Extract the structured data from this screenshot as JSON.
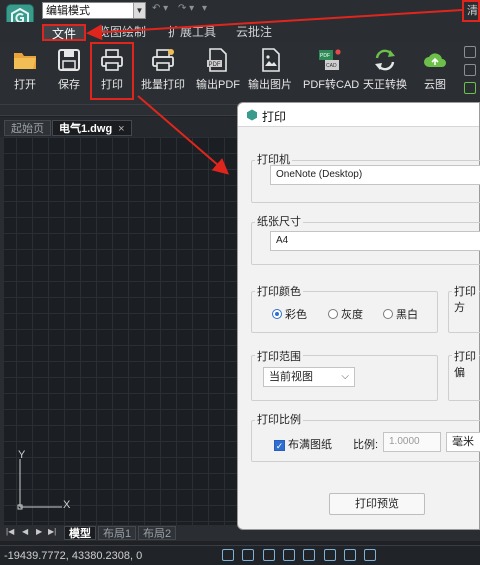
{
  "app": {
    "mode_select": "编辑模式",
    "title_right_text": "清"
  },
  "menu": {
    "items": [
      "文件",
      "览图绘制",
      "扩展工具",
      "云批注"
    ]
  },
  "ribbon": {
    "tools": [
      {
        "label": "打开",
        "icon": "folder-open-icon"
      },
      {
        "label": "保存",
        "icon": "save-icon"
      },
      {
        "label": "打印",
        "icon": "printer-icon"
      },
      {
        "label": "批量打印",
        "icon": "batch-print-icon"
      },
      {
        "label": "输出PDF",
        "icon": "pdf-export-icon"
      },
      {
        "label": "输出图片",
        "icon": "image-export-icon"
      },
      {
        "label": "PDF转CAD",
        "icon": "pdf-to-cad-icon"
      },
      {
        "label": "天正转换",
        "icon": "convert-icon"
      },
      {
        "label": "云图",
        "icon": "cloud-icon"
      }
    ]
  },
  "doc_tabs": {
    "start": "起始页",
    "active": "电气1.dwg",
    "close": "×"
  },
  "canvas": {
    "y_label": "Y",
    "x_label": "X"
  },
  "layout_tabs": {
    "nav": [
      "|◀",
      "◀",
      "▶",
      "▶|"
    ],
    "tabs": [
      "模型",
      "布局1",
      "布局2"
    ]
  },
  "status": {
    "coords": "-19439.7772, 43380.2308, 0"
  },
  "dialog": {
    "title": "打印",
    "printer": {
      "label": "打印机",
      "value": "OneNote (Desktop)"
    },
    "paper": {
      "label": "纸张尺寸",
      "value": "A4"
    },
    "color": {
      "label": "打印颜色",
      "options": [
        "彩色",
        "灰度",
        "黑白"
      ],
      "selected": "彩色"
    },
    "direction_label": "打印方",
    "range": {
      "label": "打印范围",
      "value": "当前视图"
    },
    "offset_label": "打印偏",
    "scale": {
      "label": "打印比例",
      "fit_label": "布满图纸",
      "fit_checked": true,
      "ratio_label": "比例:",
      "ratio_value": "1.0000",
      "unit": "毫米"
    },
    "preview_button": "打印预览"
  },
  "colors": {
    "annotation_red": "#e0261c",
    "dialog_accent": "#2f6fd1"
  }
}
